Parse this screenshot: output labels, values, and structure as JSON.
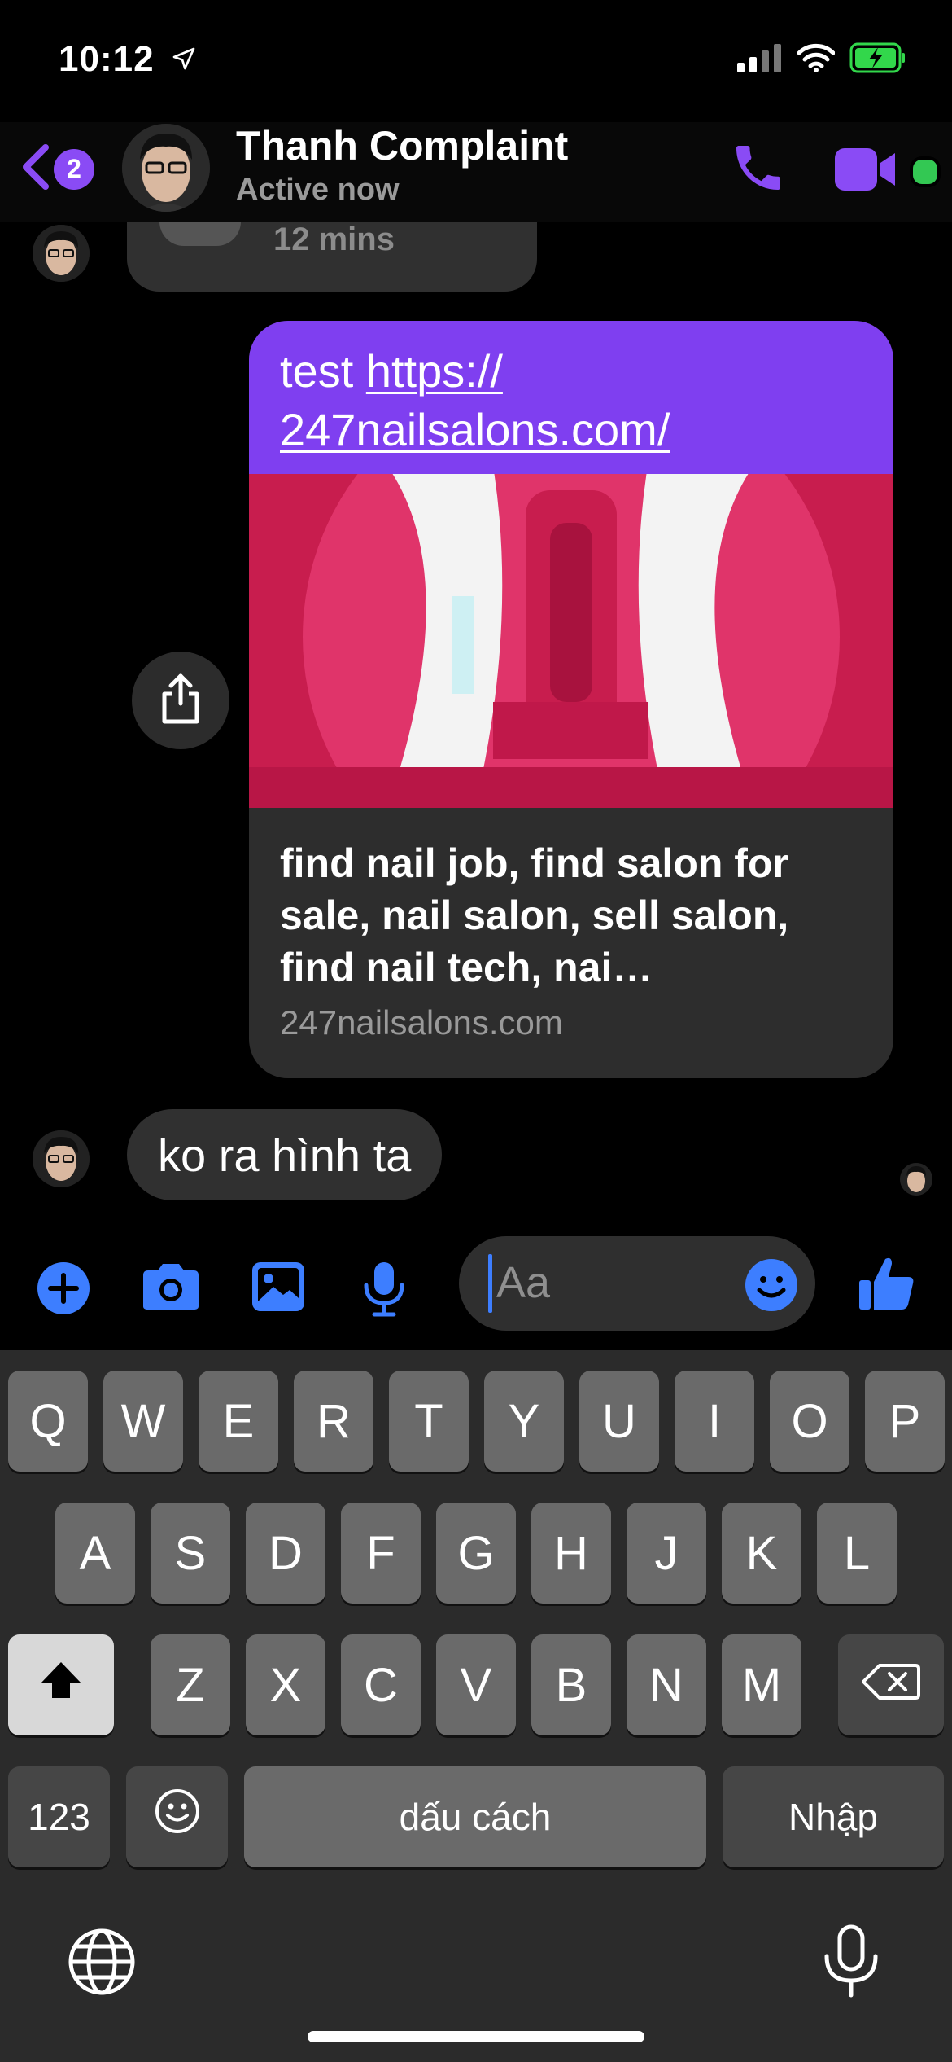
{
  "status_bar": {
    "time": "10:12"
  },
  "header": {
    "back_badge_count": "2",
    "contact_name": "Thanh Complaint",
    "contact_status": "Active now"
  },
  "messages": {
    "previous_duration": "12 mins",
    "link_message": {
      "prefix": "test ",
      "url_line1": "https://",
      "url_line2": "247nailsalons.com/",
      "preview_title": "find nail job, find salon for sale, nail salon, sell salon, find nail tech, nai…",
      "preview_domain": "247nailsalons.com"
    },
    "reply": "ko ra hình ta"
  },
  "composer": {
    "placeholder": "Aa"
  },
  "keyboard": {
    "row1": [
      "Q",
      "W",
      "E",
      "R",
      "T",
      "Y",
      "U",
      "I",
      "O",
      "P"
    ],
    "row2": [
      "A",
      "S",
      "D",
      "F",
      "G",
      "H",
      "J",
      "K",
      "L"
    ],
    "row3": [
      "Z",
      "X",
      "C",
      "V",
      "B",
      "N",
      "M"
    ],
    "numbers_key": "123",
    "space_key": "dấu cách",
    "return_key": "Nhập"
  },
  "colors": {
    "accent_purple": "#8a4bf5",
    "message_purple": "#7f3ff0",
    "composer_blue": "#3d7eff",
    "active_green": "#33c853"
  },
  "icons": {
    "back": "chevron-left-icon",
    "call": "phone-icon",
    "video": "video-camera-icon",
    "share": "share-icon",
    "add": "plus-circle-icon",
    "camera": "camera-icon",
    "gallery": "image-icon",
    "voice": "microphone-icon",
    "emoji": "emoji-icon",
    "like": "thumbs-up-icon",
    "globe": "globe-icon",
    "dictation": "microphone-icon"
  }
}
